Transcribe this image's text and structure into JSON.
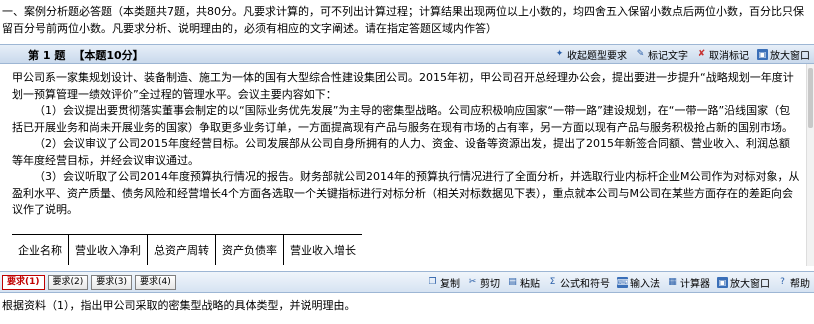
{
  "instructions": "一、案例分析题必答题（本类题共7题，共80分。凡要求计算的，可不列出计算过程；计算结果出现两位以上小数的，均四舍五入保留小数点后两位小数，百分比只保留百分号前两位小数。凡要求分析、说明理由的，必须有相应的文字阐述。请在指定答题区域内作答）",
  "question_header": {
    "number": "第 1 题",
    "points": "【本题10分】"
  },
  "tools": [
    {
      "icon": "star-icon",
      "label": "收起题型要求"
    },
    {
      "icon": "mark-icon",
      "label": "标记文字"
    },
    {
      "icon": "cancel-icon",
      "label": "取消标记"
    },
    {
      "icon": "maximize-icon",
      "label": "放大窗口"
    }
  ],
  "paragraphs": [
    "甲公司系一家集规划设计、装备制造、施工为一体的国有大型综合性建设集团公司。2015年初，甲公司召开总经理办公会，提出要进一步提升“战略规划一年度计划一预算管理一绩效评价”全过程的管理水平。会议主要内容如下：",
    "（1）会议提出要贯彻落实董事会制定的以“国际业务优先发展”为主导的密集型战略。公司应积极响应国家“一带一路”建设规划，在“一带一路”沿线国家（包括已开展业务和尚未开展业务的国家）争取更多业务订单，一方面提高现有产品与服务在现有市场的占有率，另一方面以现有产品与服务积极抢占新的国别市场。",
    "（2）会议审议了公司2015年度经营目标。公司发展部从公司自身所拥有的人力、资金、设备等资源出发，提出了2015年新签合同额、营业收入、利润总额等年度经营目标，并经会议审议通过。",
    "（3）会议听取了公司2014年度预算执行情况的报告。财务部就公司2014年的预算执行情况进行了全面分析，并选取行业内标杆企业M公司作为对标对象，从盈利水平、资产质量、债务风险和经营增长4个方面各选取一个关键指标进行对标分析（相关对标数据见下表），重点就本公司与M公司在某些方面存在的差距向会议作了说明。"
  ],
  "table_headers": [
    "企业名称",
    "营业收入净利",
    "总资产周转",
    "资产负债率",
    "营业收入增长"
  ],
  "subtabs": [
    "要求(1)",
    "要求(2)",
    "要求(3)",
    "要求(4)"
  ],
  "editor_tools": [
    {
      "icon": "copy-icon",
      "label": "复制"
    },
    {
      "icon": "cut-icon",
      "label": "剪切"
    },
    {
      "icon": "paste-icon",
      "label": "粘贴"
    },
    {
      "icon": "formula-icon",
      "label": "公式和符号"
    },
    {
      "icon": "input-method-icon",
      "label": "输入法"
    },
    {
      "icon": "calculator-icon",
      "label": "计算器"
    },
    {
      "icon": "maximize-icon",
      "label": "放大窗口"
    },
    {
      "icon": "help-icon",
      "label": "帮助"
    }
  ],
  "answer_prompt": "根据资料（1），指出甲公司采取的密集型战略的具体类型，并说明理由。"
}
